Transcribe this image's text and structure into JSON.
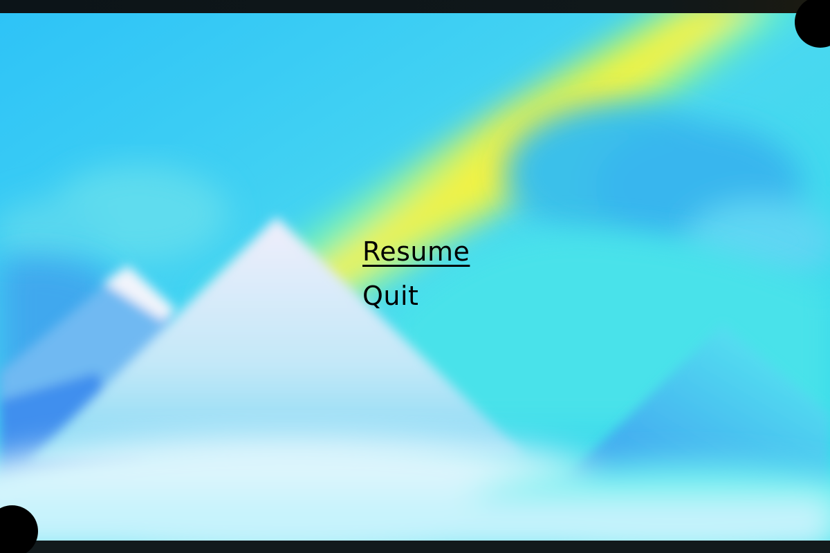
{
  "pause_menu": {
    "items": [
      {
        "label": "Resume",
        "selected": true
      },
      {
        "label": "Quit",
        "selected": false
      }
    ]
  },
  "colors": {
    "text": "#000000",
    "frame": "#0b1114",
    "sky": "#38c8f5",
    "rainbow_yellow": "#f5f23a",
    "snow": "#eef0fb"
  }
}
